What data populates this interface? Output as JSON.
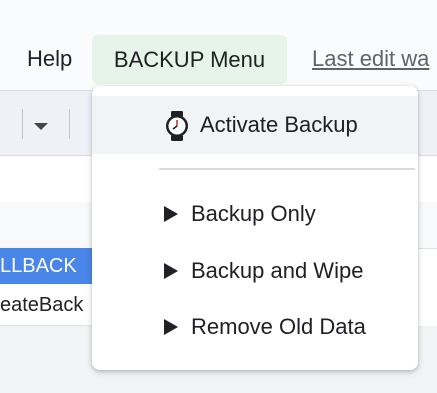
{
  "menubar": {
    "help": "Help",
    "backup_menu": "BACKUP Menu",
    "last_edit": "Last edit wa"
  },
  "sheet": {
    "cell_row1": "LLBACK",
    "cell_row2": "eateBack"
  },
  "dropdown": {
    "items": [
      {
        "label": "Activate Backup",
        "icon": "watch-icon"
      },
      {
        "label": "Backup Only",
        "icon": "play-arrow-icon"
      },
      {
        "label": "Backup and Wipe",
        "icon": "play-arrow-icon"
      },
      {
        "label": "Remove Old Data",
        "icon": "play-arrow-icon"
      }
    ]
  },
  "colors": {
    "menu_highlight": "#e6f4ea",
    "selected_cell": "#4a86e8",
    "hover_item": "#f1f3f4"
  }
}
